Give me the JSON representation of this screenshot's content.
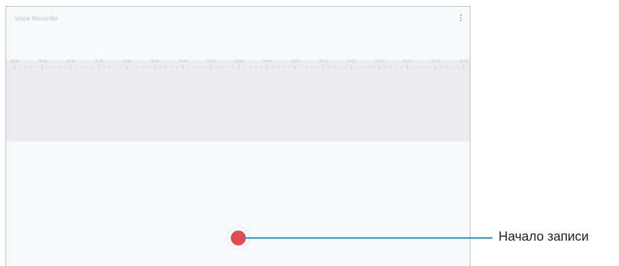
{
  "app": {
    "title": "Voice Recorder"
  },
  "toolbar": {
    "more_icon": "more-vertical-icon"
  },
  "ruler": {
    "tick_labels": [
      "00:00",
      "00:01",
      "00:02",
      "00:03",
      "00:04",
      "00:05",
      "00:06",
      "00:07",
      "00:08",
      "00:09",
      "00:10",
      "00:11",
      "00:12",
      "00:13",
      "00:14",
      "00:15",
      "00:16"
    ]
  },
  "record": {
    "icon": "record-icon",
    "color": "#e04b52"
  },
  "callout": {
    "label": "Начало записи",
    "line_color": "#2a8fc8"
  }
}
